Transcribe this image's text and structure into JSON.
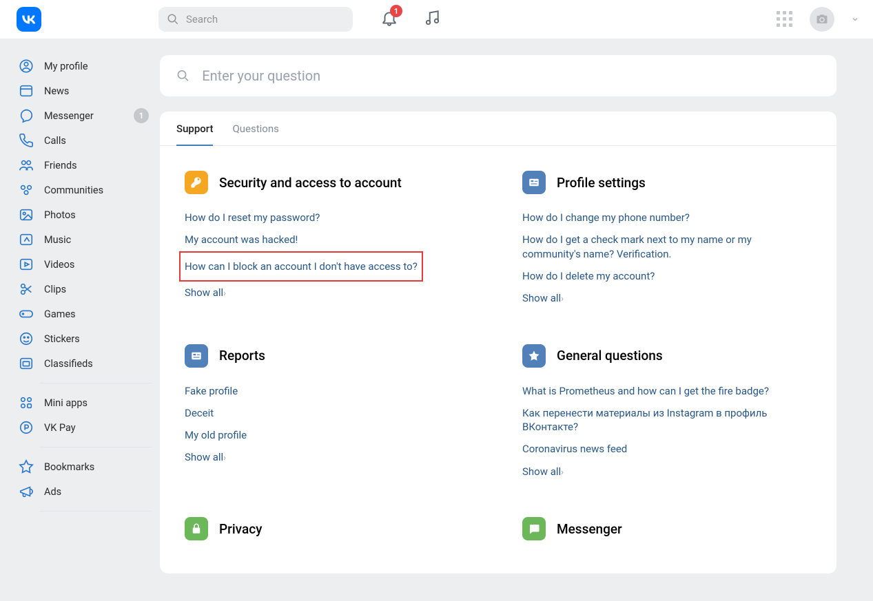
{
  "header": {
    "search_placeholder": "Search",
    "notif_count": "1"
  },
  "sidebar": {
    "items": [
      {
        "label": "My profile"
      },
      {
        "label": "News"
      },
      {
        "label": "Messenger",
        "badge": "1"
      },
      {
        "label": "Calls"
      },
      {
        "label": "Friends"
      },
      {
        "label": "Communities"
      },
      {
        "label": "Photos"
      },
      {
        "label": "Music"
      },
      {
        "label": "Videos"
      },
      {
        "label": "Clips"
      },
      {
        "label": "Games"
      },
      {
        "label": "Stickers"
      },
      {
        "label": "Classifieds"
      }
    ],
    "items2": [
      {
        "label": "Mini apps"
      },
      {
        "label": "VK Pay"
      }
    ],
    "items3": [
      {
        "label": "Bookmarks"
      },
      {
        "label": "Ads"
      }
    ]
  },
  "main": {
    "search_placeholder": "Enter your question",
    "tabs": [
      {
        "label": "Support"
      },
      {
        "label": "Questions"
      }
    ],
    "show_all_label": "Show all",
    "sections": {
      "security": {
        "title": "Security and access to account",
        "links": [
          "How do I reset my password?",
          "My account was hacked!",
          "How can I block an account I don't have access to?"
        ]
      },
      "profile": {
        "title": "Profile settings",
        "links": [
          "How do I change my phone number?",
          "How do I get a check mark next to my name or my community's name? Verification.",
          "How do I delete my account?"
        ]
      },
      "reports": {
        "title": "Reports",
        "links": [
          "Fake profile",
          "Deceit",
          "My old profile"
        ]
      },
      "general": {
        "title": "General questions",
        "links": [
          "What is Prometheus and how can I get the fire badge?",
          "Как перенести материалы из Instagram в профиль ВКонтакте?",
          "Coronavirus news feed"
        ]
      },
      "privacy": {
        "title": "Privacy"
      },
      "messenger": {
        "title": "Messenger"
      }
    }
  }
}
